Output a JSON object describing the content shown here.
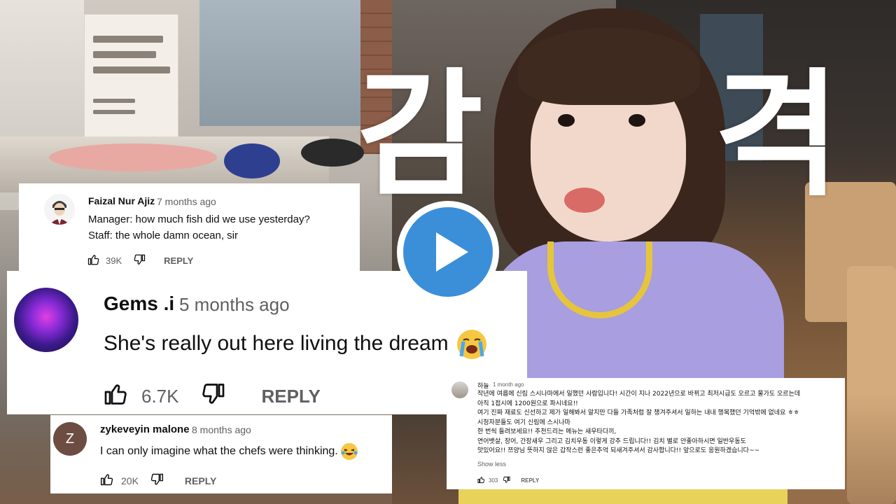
{
  "thumbnail": {
    "title_text": "감격",
    "title_char_1": "감",
    "title_char_2": "격",
    "play_button_label": "play"
  },
  "comments": [
    {
      "author": "Faizal Nur Ajiz",
      "time": "7 months ago",
      "lines": [
        "Manager: how much fish did we use yesterday?",
        "Staff: the whole damn ocean, sir"
      ],
      "likes": "39K",
      "reply_label": "REPLY"
    },
    {
      "author": "Gems .i",
      "time": "5 months ago",
      "text": "She's really out here living the dream",
      "emoji": "loudly-crying-face",
      "likes": "6.7K",
      "reply_label": "REPLY"
    },
    {
      "author": "zykeveyin malone",
      "avatar_letter": "Z",
      "time": "8 months ago",
      "text": "I can only imagine what the chefs were thinking.",
      "emoji": "laughing-tears-face",
      "likes": "20K",
      "reply_label": "REPLY"
    },
    {
      "author": "하늘",
      "time": "1 month ago",
      "lines": [
        "작년에 여름에 신림 스시나마에서 일했던 사람입니다! 시간이 지나 2022년으로 바뀌고 최저시급도 오르고 물가도 오르는데",
        "아직 1접시에 1200원으로 파시네요!!",
        "여기 진짜 재료도 신선하고 제가 일해봐서 알지만 다들 가족처럼 잘 챙겨주셔서 일하는 내내 행복했던 기억밖에 없네요 ㅎㅎ",
        "시청자분들도 여기 신림에 스시나마",
        "한 번씩 들려보세요!! 추천드리는 메뉴는 새우타다끼,",
        "연어뱃살, 장어, 간장새우 그리고 김치우동 이렇게 강추 드립니다!! 김치 별로 안좋아하시면 일반우동도",
        "맛있어요!! 쯔양님 뜻하지 않은 갑작스런 좋은추억 되새겨주셔서 감사합니다!! 앞으로도 응원하겠습니다~~"
      ],
      "show_less": "Show less",
      "likes": "303",
      "reply_label": "REPLY"
    }
  ],
  "colors": {
    "card_bg": "#ffffff",
    "text_primary": "#0f0f0f",
    "text_secondary": "#606060",
    "play_blue": "#3a8fd8",
    "shirt": "#a89ee0",
    "collar": "#e6c53c"
  }
}
